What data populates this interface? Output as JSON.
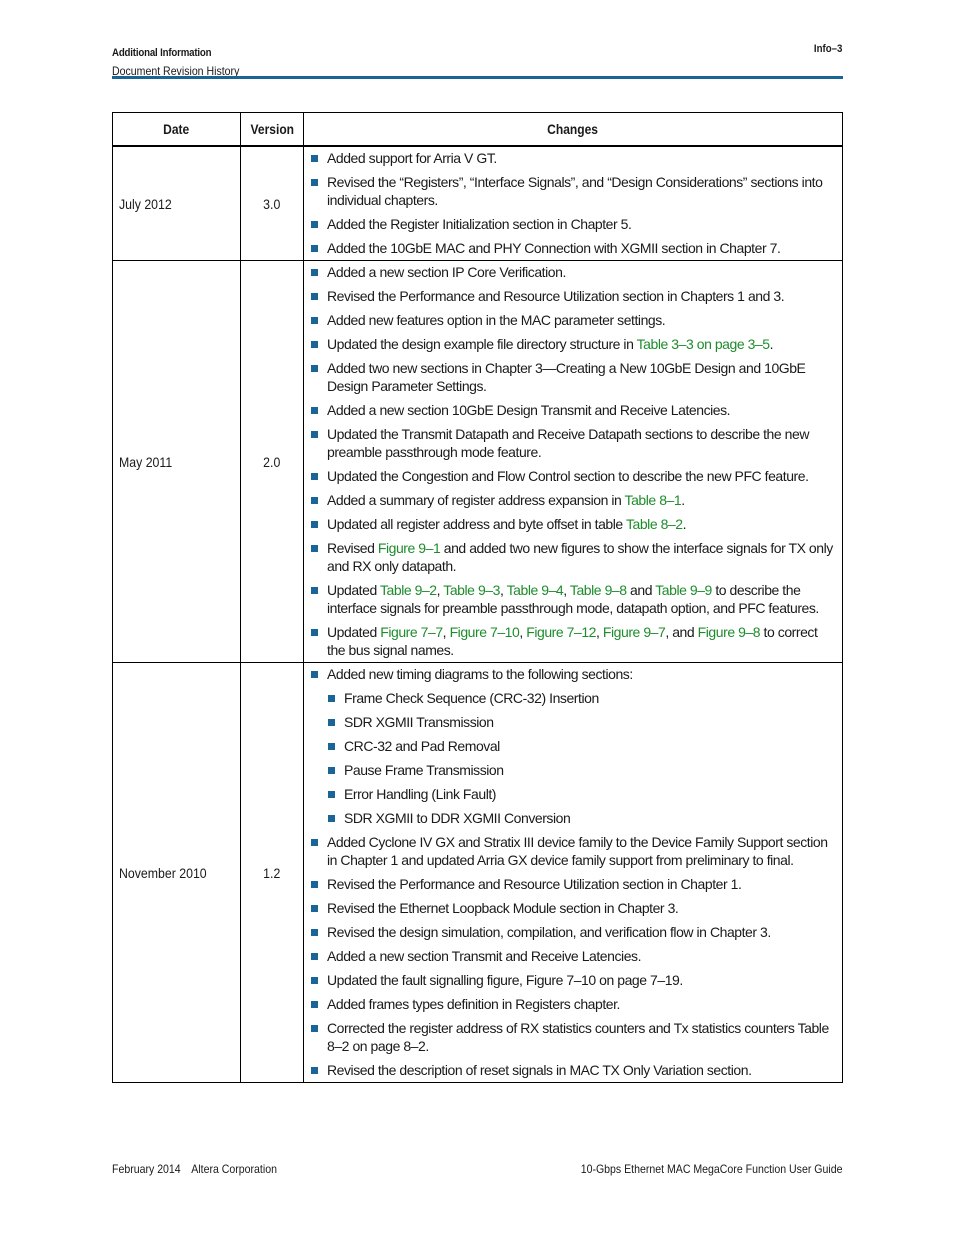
{
  "header": {
    "section": "Additional Information",
    "subsection": "Document Revision History",
    "page": "Info–3",
    "rule_color": "#1a6496"
  },
  "table": {
    "columns": [
      "Date",
      "Version",
      "Changes"
    ],
    "rows": [
      {
        "date": "July 2012",
        "version": "3.0",
        "changes": [
          {
            "parts": [
              {
                "t": "Added support for Arria V GT."
              }
            ]
          },
          {
            "parts": [
              {
                "t": "Revised the “Registers”, “Interface Signals”, and “Design Considerations” sections into individual chapters."
              }
            ]
          },
          {
            "parts": [
              {
                "t": "Added the Register Initialization section in Chapter 5."
              }
            ]
          },
          {
            "parts": [
              {
                "t": "Added the 10GbE MAC and PHY Connection with XGMII section in Chapter 7."
              }
            ]
          }
        ]
      },
      {
        "date": "May 2011",
        "version": "2.0",
        "changes": [
          {
            "parts": [
              {
                "t": "Added a new section IP Core Verification."
              }
            ]
          },
          {
            "parts": [
              {
                "t": "Revised the Performance and Resource Utilization section in Chapters 1 and 3."
              }
            ]
          },
          {
            "parts": [
              {
                "t": "Added new features option in the MAC parameter settings."
              }
            ]
          },
          {
            "parts": [
              {
                "t": "Updated the design example file directory structure in "
              },
              {
                "t": "Table 3–3 on page 3–5",
                "link": true
              },
              {
                "t": "."
              }
            ]
          },
          {
            "parts": [
              {
                "t": "Added two new sections in Chapter 3—Creating a New 10GbE Design and 10GbE Design Parameter Settings."
              }
            ]
          },
          {
            "parts": [
              {
                "t": "Added a new section 10GbE Design Transmit and Receive Latencies."
              }
            ]
          },
          {
            "parts": [
              {
                "t": "Updated the Transmit Datapath and Receive Datapath sections to describe the new preamble passthrough mode feature."
              }
            ]
          },
          {
            "parts": [
              {
                "t": "Updated the Congestion and Flow Control section to describe the new PFC feature."
              }
            ]
          },
          {
            "parts": [
              {
                "t": "Added a summary of register address expansion in "
              },
              {
                "t": "Table 8–1",
                "link": true
              },
              {
                "t": "."
              }
            ]
          },
          {
            "parts": [
              {
                "t": "Updated all register address and byte offset in table "
              },
              {
                "t": "Table 8–2",
                "link": true
              },
              {
                "t": "."
              }
            ]
          },
          {
            "parts": [
              {
                "t": "Revised "
              },
              {
                "t": "Figure 9–1",
                "link": true
              },
              {
                "t": " and added two new figures to show the interface signals for TX only and RX only datapath."
              }
            ]
          },
          {
            "parts": [
              {
                "t": "Updated "
              },
              {
                "t": "Table 9–2",
                "link": true
              },
              {
                "t": ", "
              },
              {
                "t": "Table 9–3",
                "link": true
              },
              {
                "t": ", "
              },
              {
                "t": "Table 9–4",
                "link": true
              },
              {
                "t": ", "
              },
              {
                "t": "Table 9–8",
                "link": true
              },
              {
                "t": " and "
              },
              {
                "t": "Table 9–9",
                "link": true
              },
              {
                "t": " to describe the interface signals for preamble passthrough mode, datapath option, and PFC features."
              }
            ]
          },
          {
            "parts": [
              {
                "t": "Updated "
              },
              {
                "t": "Figure 7–7",
                "link": true
              },
              {
                "t": ", "
              },
              {
                "t": "Figure 7–10",
                "link": true
              },
              {
                "t": ", "
              },
              {
                "t": "Figure 7–12",
                "link": true
              },
              {
                "t": ", "
              },
              {
                "t": "Figure 9–7",
                "link": true
              },
              {
                "t": ", and "
              },
              {
                "t": "Figure 9–8",
                "link": true
              },
              {
                "t": " to correct the bus signal names."
              }
            ]
          }
        ]
      },
      {
        "date": "November 2010",
        "version": "1.2",
        "changes": [
          {
            "parts": [
              {
                "t": "Added new timing diagrams to the following sections:"
              }
            ],
            "sub": [
              "Frame Check Sequence (CRC-32) Insertion",
              "SDR XGMII Transmission",
              "CRC-32 and Pad Removal",
              "Pause Frame Transmission",
              "Error Handling (Link Fault)",
              "SDR XGMII to DDR XGMII Conversion"
            ]
          },
          {
            "parts": [
              {
                "t": "Added Cyclone IV GX and Stratix III device family to the Device Family Support section in Chapter 1 and updated Arria GX device family support from preliminary to final."
              }
            ]
          },
          {
            "parts": [
              {
                "t": "Revised the Performance and Resource Utilization section in Chapter 1."
              }
            ]
          },
          {
            "parts": [
              {
                "t": "Revised the Ethernet Loopback Module section in Chapter 3."
              }
            ]
          },
          {
            "parts": [
              {
                "t": "Revised the design simulation, compilation, and verification flow in Chapter 3."
              }
            ]
          },
          {
            "parts": [
              {
                "t": "Added a new section Transmit and Receive Latencies."
              }
            ]
          },
          {
            "parts": [
              {
                "t": "Updated the fault signalling figure, Figure 7–10 on page 7–19."
              }
            ]
          },
          {
            "parts": [
              {
                "t": "Added frames types definition in Registers chapter."
              }
            ]
          },
          {
            "parts": [
              {
                "t": "Corrected the register address of RX statistics counters and Tx statistics counters Table 8–2 on page 8–2."
              }
            ]
          },
          {
            "parts": [
              {
                "t": "Revised the description of reset signals in MAC TX Only Variation section."
              }
            ]
          }
        ]
      }
    ]
  },
  "footer": {
    "date": "February 2014",
    "company": "Altera Corporation",
    "title": "10-Gbps Ethernet MAC MegaCore Function User Guide"
  },
  "colors": {
    "bullet": "#1a6496",
    "link": "#1e8c2c"
  }
}
